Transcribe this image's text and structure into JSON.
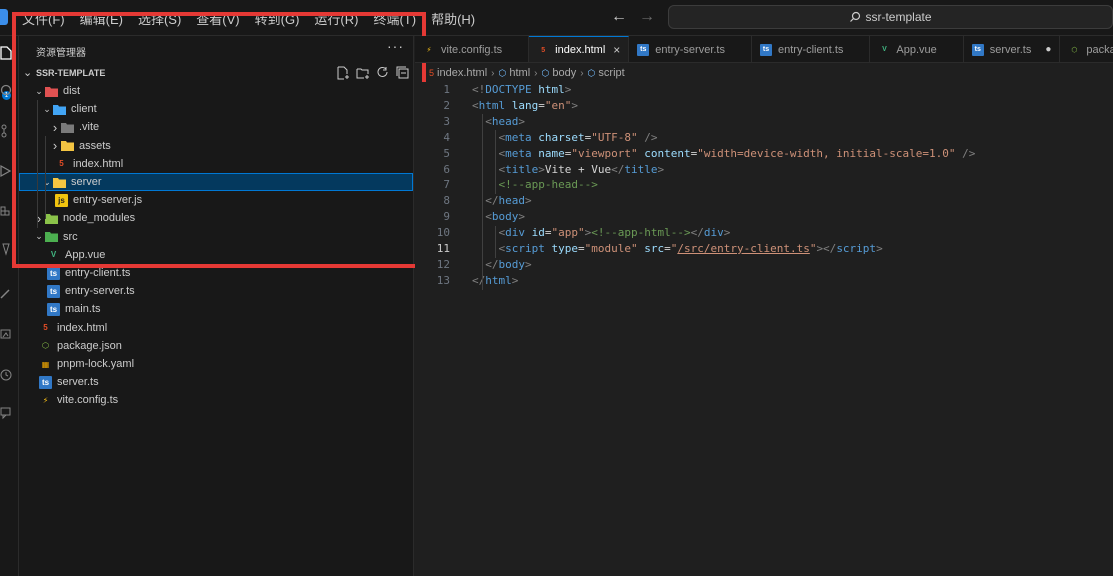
{
  "titlebar": {
    "menus": [
      "文件(F)",
      "编辑(E)",
      "选择(S)",
      "查看(V)",
      "转到(G)",
      "运行(R)",
      "终端(T)",
      "帮助(H)"
    ],
    "search_text": "ssr-template"
  },
  "sidebar": {
    "title": "资源管理器",
    "more": "···",
    "section_title": "SSR-TEMPLATE",
    "tree": [
      {
        "label": "dist",
        "depth": 0,
        "type": "folder",
        "expanded": true,
        "icon": "dist-folder-icon"
      },
      {
        "label": "client",
        "depth": 1,
        "type": "folder",
        "expanded": true,
        "icon": "client-folder-icon"
      },
      {
        "label": ".vite",
        "depth": 2,
        "type": "folder",
        "expanded": false,
        "icon": "vite-folder-icon"
      },
      {
        "label": "assets",
        "depth": 2,
        "type": "folder",
        "expanded": false,
        "icon": "assets-folder-icon"
      },
      {
        "label": "index.html",
        "depth": 2,
        "type": "file",
        "icon": "html-file-icon"
      },
      {
        "label": "server",
        "depth": 1,
        "type": "folder",
        "expanded": true,
        "selected": true,
        "icon": "server-folder-icon"
      },
      {
        "label": "entry-server.js",
        "depth": 2,
        "type": "file",
        "icon": "js-file-icon"
      },
      {
        "label": "node_modules",
        "depth": 0,
        "type": "folder",
        "expanded": false,
        "icon": "node-modules-folder-icon"
      },
      {
        "label": "src",
        "depth": 0,
        "type": "folder",
        "expanded": true,
        "icon": "src-folder-icon"
      },
      {
        "label": "App.vue",
        "depth": 1,
        "type": "file",
        "icon": "vue-file-icon"
      },
      {
        "label": "entry-client.ts",
        "depth": 1,
        "type": "file",
        "icon": "ts-file-icon"
      },
      {
        "label": "entry-server.ts",
        "depth": 1,
        "type": "file",
        "icon": "ts-file-icon"
      },
      {
        "label": "main.ts",
        "depth": 1,
        "type": "file",
        "icon": "ts-file-icon"
      },
      {
        "label": "index.html",
        "depth": 0,
        "type": "file",
        "icon": "html-file-icon"
      },
      {
        "label": "package.json",
        "depth": 0,
        "type": "file",
        "icon": "node-file-icon"
      },
      {
        "label": "pnpm-lock.yaml",
        "depth": 0,
        "type": "file",
        "icon": "pnpm-file-icon"
      },
      {
        "label": "server.ts",
        "depth": 0,
        "type": "file",
        "icon": "ts-file-icon"
      },
      {
        "label": "vite.config.ts",
        "depth": 0,
        "type": "file",
        "icon": "vite-file-icon"
      }
    ]
  },
  "tabs": [
    {
      "label": "vite.config.ts",
      "icon": "vite-file-icon",
      "active": false
    },
    {
      "label": "index.html",
      "icon": "html-file-icon",
      "active": true,
      "closable": true
    },
    {
      "label": "entry-server.ts",
      "icon": "ts-file-icon",
      "active": false
    },
    {
      "label": "entry-client.ts",
      "icon": "ts-file-icon",
      "active": false
    },
    {
      "label": "App.vue",
      "icon": "vue-file-icon",
      "active": false
    },
    {
      "label": "server.ts",
      "icon": "ts-file-icon",
      "active": false,
      "dirty": true
    },
    {
      "label": "packa",
      "icon": "node-file-icon",
      "active": false
    }
  ],
  "breadcrumbs": [
    "index.html",
    "html",
    "body",
    "script"
  ],
  "editor": {
    "current_line": 11,
    "lines": [
      [
        [
          "t-tag",
          "<!"
        ],
        [
          "t-name",
          "DOCTYPE"
        ],
        [
          "t-txt",
          " "
        ],
        [
          "t-attr",
          "html"
        ],
        [
          "t-tag",
          ">"
        ]
      ],
      [
        [
          "t-tag",
          "<"
        ],
        [
          "t-name",
          "html"
        ],
        [
          "t-txt",
          " "
        ],
        [
          "t-attr",
          "lang"
        ],
        [
          "t-txt",
          "="
        ],
        [
          "t-str",
          "\"en\""
        ],
        [
          "t-tag",
          ">"
        ]
      ],
      [
        [
          "t-txt",
          "  "
        ],
        [
          "t-tag",
          "<"
        ],
        [
          "t-name",
          "head"
        ],
        [
          "t-tag",
          ">"
        ]
      ],
      [
        [
          "t-txt",
          "    "
        ],
        [
          "t-tag",
          "<"
        ],
        [
          "t-name",
          "meta"
        ],
        [
          "t-txt",
          " "
        ],
        [
          "t-attr",
          "charset"
        ],
        [
          "t-txt",
          "="
        ],
        [
          "t-str",
          "\"UTF-8\""
        ],
        [
          "t-txt",
          " "
        ],
        [
          "t-tag",
          "/>"
        ]
      ],
      [
        [
          "t-txt",
          "    "
        ],
        [
          "t-tag",
          "<"
        ],
        [
          "t-name",
          "meta"
        ],
        [
          "t-txt",
          " "
        ],
        [
          "t-attr",
          "name"
        ],
        [
          "t-txt",
          "="
        ],
        [
          "t-str",
          "\"viewport\""
        ],
        [
          "t-txt",
          " "
        ],
        [
          "t-attr",
          "content"
        ],
        [
          "t-txt",
          "="
        ],
        [
          "t-str",
          "\"width=device-width, initial-scale=1.0\""
        ],
        [
          "t-txt",
          " "
        ],
        [
          "t-tag",
          "/>"
        ]
      ],
      [
        [
          "t-txt",
          "    "
        ],
        [
          "t-tag",
          "<"
        ],
        [
          "t-name",
          "title"
        ],
        [
          "t-tag",
          ">"
        ],
        [
          "t-txt",
          "Vite + Vue"
        ],
        [
          "t-tag",
          "</"
        ],
        [
          "t-name",
          "title"
        ],
        [
          "t-tag",
          ">"
        ]
      ],
      [
        [
          "t-txt",
          "    "
        ],
        [
          "t-cmt",
          "<!--app-head-->"
        ]
      ],
      [
        [
          "t-txt",
          "  "
        ],
        [
          "t-tag",
          "</"
        ],
        [
          "t-name",
          "head"
        ],
        [
          "t-tag",
          ">"
        ]
      ],
      [
        [
          "t-txt",
          "  "
        ],
        [
          "t-tag",
          "<"
        ],
        [
          "t-name",
          "body"
        ],
        [
          "t-tag",
          ">"
        ]
      ],
      [
        [
          "t-txt",
          "    "
        ],
        [
          "t-tag",
          "<"
        ],
        [
          "t-name",
          "div"
        ],
        [
          "t-txt",
          " "
        ],
        [
          "t-attr",
          "id"
        ],
        [
          "t-txt",
          "="
        ],
        [
          "t-str",
          "\"app\""
        ],
        [
          "t-tag",
          ">"
        ],
        [
          "t-cmt",
          "<!--app-html-->"
        ],
        [
          "t-tag",
          "</"
        ],
        [
          "t-name",
          "div"
        ],
        [
          "t-tag",
          ">"
        ]
      ],
      [
        [
          "t-txt",
          "    "
        ],
        [
          "t-tag",
          "<"
        ],
        [
          "t-name",
          "script"
        ],
        [
          "t-txt",
          " "
        ],
        [
          "t-attr",
          "type"
        ],
        [
          "t-txt",
          "="
        ],
        [
          "t-str",
          "\"module\""
        ],
        [
          "t-txt",
          " "
        ],
        [
          "t-attr",
          "src"
        ],
        [
          "t-txt",
          "="
        ],
        [
          "t-str",
          "\""
        ],
        [
          "t-str t-und",
          "/src/entry-client.ts"
        ],
        [
          "t-str",
          "\""
        ],
        [
          "t-tag",
          "></"
        ],
        [
          "t-name",
          "script"
        ],
        [
          "t-tag",
          ">"
        ]
      ],
      [
        [
          "t-txt",
          "  "
        ],
        [
          "t-tag",
          "</"
        ],
        [
          "t-name",
          "body"
        ],
        [
          "t-tag",
          ">"
        ]
      ],
      [
        [
          "t-tag",
          "</"
        ],
        [
          "t-name",
          "html"
        ],
        [
          "t-tag",
          ">"
        ]
      ]
    ]
  },
  "colors": {
    "accent": "#0078d4",
    "highlight_border": "#e53935",
    "selection": "#04395e"
  }
}
